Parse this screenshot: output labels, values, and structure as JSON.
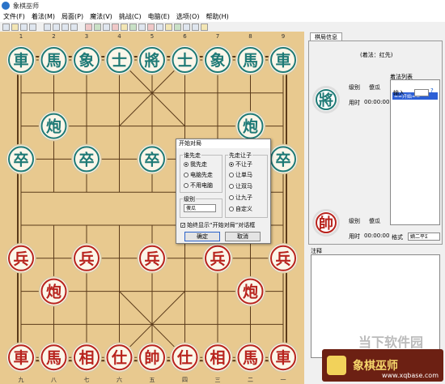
{
  "window": {
    "title": "象棋巫师"
  },
  "menu": [
    "文件(F)",
    "着法(M)",
    "局面(P)",
    "魔法(V)",
    "挑战(C)",
    "电脑(E)",
    "选项(O)",
    "帮助(H)"
  ],
  "board": {
    "top_numbers": [
      "1",
      "2",
      "3",
      "4",
      "5",
      "6",
      "7",
      "8",
      "9"
    ],
    "bottom_numbers": [
      "九",
      "八",
      "七",
      "六",
      "五",
      "四",
      "三",
      "二",
      "一"
    ],
    "pieces": [
      {
        "c": "車",
        "side": "black",
        "f": 0,
        "r": 0
      },
      {
        "c": "馬",
        "side": "black",
        "f": 1,
        "r": 0
      },
      {
        "c": "象",
        "side": "black",
        "f": 2,
        "r": 0
      },
      {
        "c": "士",
        "side": "black",
        "f": 3,
        "r": 0
      },
      {
        "c": "將",
        "side": "black",
        "f": 4,
        "r": 0
      },
      {
        "c": "士",
        "side": "black",
        "f": 5,
        "r": 0
      },
      {
        "c": "象",
        "side": "black",
        "f": 6,
        "r": 0
      },
      {
        "c": "馬",
        "side": "black",
        "f": 7,
        "r": 0
      },
      {
        "c": "車",
        "side": "black",
        "f": 8,
        "r": 0
      },
      {
        "c": "炮",
        "side": "black",
        "f": 1,
        "r": 2
      },
      {
        "c": "炮",
        "side": "black",
        "f": 7,
        "r": 2
      },
      {
        "c": "卒",
        "side": "black",
        "f": 0,
        "r": 3
      },
      {
        "c": "卒",
        "side": "black",
        "f": 2,
        "r": 3
      },
      {
        "c": "卒",
        "side": "black",
        "f": 4,
        "r": 3
      },
      {
        "c": "卒",
        "side": "black",
        "f": 6,
        "r": 3
      },
      {
        "c": "卒",
        "side": "black",
        "f": 8,
        "r": 3
      },
      {
        "c": "兵",
        "side": "red",
        "f": 0,
        "r": 6
      },
      {
        "c": "兵",
        "side": "red",
        "f": 2,
        "r": 6
      },
      {
        "c": "兵",
        "side": "red",
        "f": 4,
        "r": 6
      },
      {
        "c": "兵",
        "side": "red",
        "f": 6,
        "r": 6
      },
      {
        "c": "兵",
        "side": "red",
        "f": 8,
        "r": 6
      },
      {
        "c": "炮",
        "side": "red",
        "f": 1,
        "r": 7
      },
      {
        "c": "炮",
        "side": "red",
        "f": 7,
        "r": 7
      },
      {
        "c": "車",
        "side": "red",
        "f": 0,
        "r": 9
      },
      {
        "c": "馬",
        "side": "red",
        "f": 1,
        "r": 9
      },
      {
        "c": "相",
        "side": "red",
        "f": 2,
        "r": 9
      },
      {
        "c": "仕",
        "side": "red",
        "f": 3,
        "r": 9
      },
      {
        "c": "帥",
        "side": "red",
        "f": 4,
        "r": 9
      },
      {
        "c": "仕",
        "side": "red",
        "f": 5,
        "r": 9
      },
      {
        "c": "相",
        "side": "red",
        "f": 6,
        "r": 9
      },
      {
        "c": "馬",
        "side": "red",
        "f": 7,
        "r": 9
      },
      {
        "c": "車",
        "side": "red",
        "f": 8,
        "r": 9
      }
    ],
    "colors": {
      "black": "#1f7a76",
      "red": "#b8231d",
      "board": "#e8c98f",
      "line": "#5a3a1a"
    }
  },
  "panel": {
    "tab": "棋局信息",
    "move_order": "(着法：红先)",
    "top": {
      "piece": "將",
      "level_label": "级别",
      "level_value": "傻瓜",
      "time_label": "用时",
      "time_value": "00:00:00"
    },
    "bottom": {
      "piece": "帥",
      "level_label": "级别",
      "level_value": "傻瓜",
      "time_label": "用时",
      "time_value": "00:00:00"
    },
    "record_header": "着法列表",
    "input_label": "输入",
    "help_button": "?",
    "record_item": "==开始==",
    "format_label": "格式",
    "format_value": "嫡二平Σ",
    "note_label": "注释"
  },
  "dialog": {
    "title": "开始对局",
    "who_first": {
      "label": "谁先走",
      "options": [
        "我先走",
        "电脑先走",
        "不用电脑"
      ],
      "selected": 0
    },
    "handicap": {
      "label": "先走让子",
      "options": [
        "不让子",
        "让单马",
        "让双马",
        "让九子",
        "自定义"
      ],
      "selected": 0
    },
    "level": {
      "label": "级别",
      "value": "傻瓜"
    },
    "checkbox": {
      "label": "始终显示“开始对局”对话框",
      "checked": true
    },
    "ok": "确定",
    "cancel": "取消"
  },
  "watermark": {
    "text": "当下软件园",
    "logo_text": "象棋巫师",
    "logo_url": "www.xqbase.com"
  }
}
